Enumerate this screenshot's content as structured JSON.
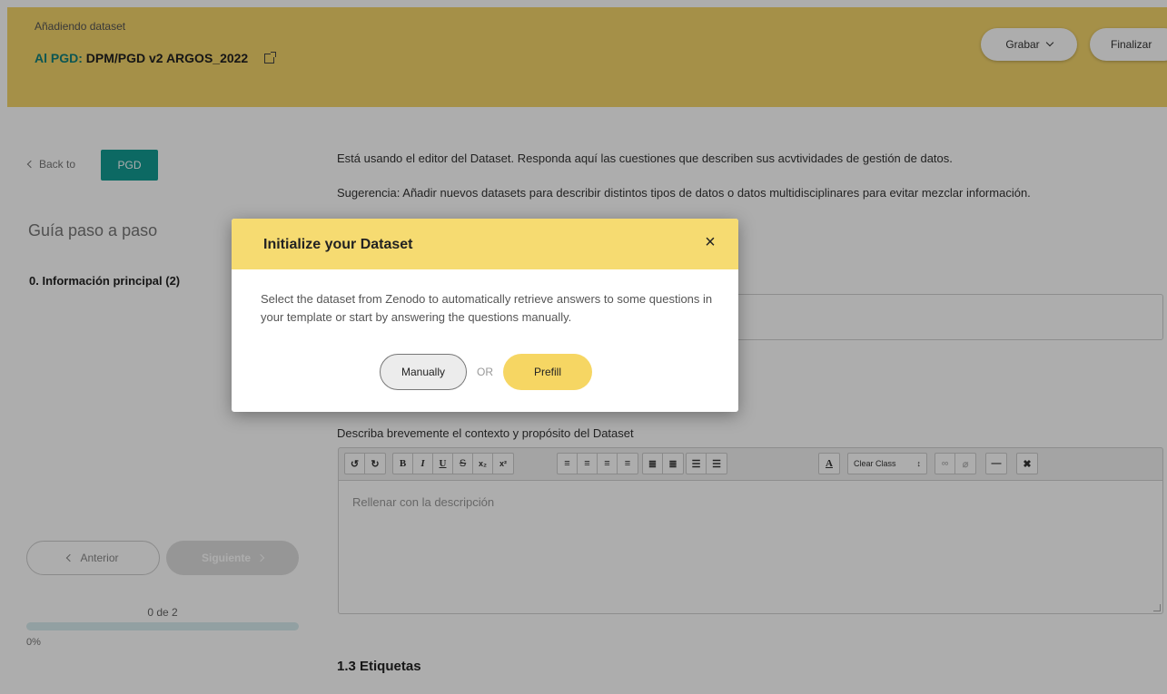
{
  "header": {
    "subtitle": "Añadiendo dataset",
    "title_prefix": "Al PGD:",
    "title_name": " DPM/PGD v2 ARGOS_2022",
    "save_label": "Grabar",
    "finish_label": "Finalizar"
  },
  "sidebar": {
    "back_label": "Back to",
    "pgd_label": "PGD",
    "guide_title": "Guía paso a paso",
    "steps": [
      {
        "label": "0. Información principal (2)"
      }
    ],
    "prev_label": "Anterior",
    "next_label": "Siguiente",
    "progress_text": "0 de 2",
    "progress_percent_text": "0%",
    "progress_fraction": 0
  },
  "main": {
    "intro_line1": "Está usando el editor del Dataset. Responda aquí las cuestiones que describen sus acvtividades de gestión de datos.",
    "intro_line2": "Sugerencia: Añadir nuevos datasets para describir distintos tipos de datos o datos multidisciplinares para evitar mezclar información.",
    "description_label": "Describa brevemente el contexto y propósito del Dataset",
    "editor_placeholder": "Rellenar con la descripción",
    "toolbar": {
      "clear_class_label": "Clear Class"
    },
    "next_section_title": "1.3 Etiquetas"
  },
  "modal": {
    "title": "Initialize your Dataset",
    "close_symbol": "×",
    "body": "Select the dataset from Zenodo to automatically retrieve answers to some questions in your template or start by answering the questions manually.",
    "manual_label": "Manually",
    "or_label": "OR",
    "prefill_label": "Prefill"
  },
  "colors": {
    "header_bg": "#f3d46b",
    "accent_teal": "#129b92",
    "modal_head_bg": "#f6db71",
    "prefill_bg": "#f6d663"
  }
}
